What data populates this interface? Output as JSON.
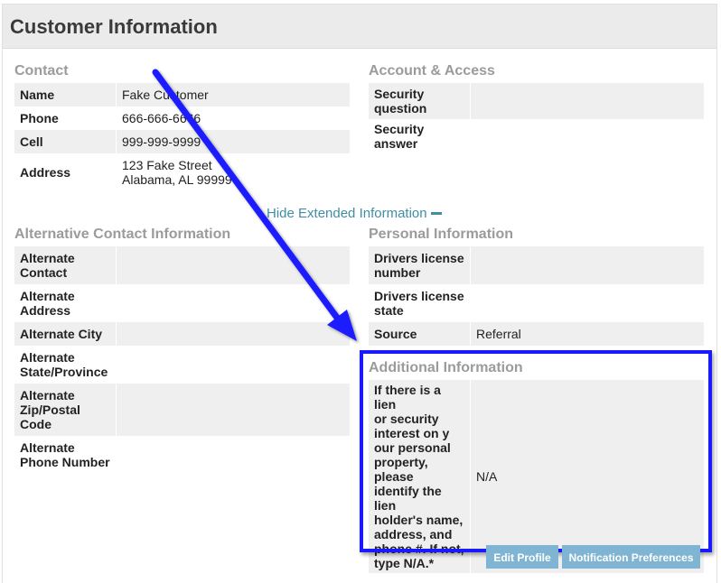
{
  "title": "Customer Information",
  "contact": {
    "heading": "Contact",
    "rows": [
      {
        "label": "Name",
        "value": "Fake Customer"
      },
      {
        "label": "Phone",
        "value": "666-666-6666"
      },
      {
        "label": "Cell",
        "value": "999-999-9999"
      },
      {
        "label": "Address",
        "value_line1": "123 Fake Street",
        "value_line2": "Alabama, AL 99999"
      }
    ]
  },
  "account": {
    "heading": "Account & Access",
    "rows": [
      {
        "label_line1": "Security",
        "label_line2": "question",
        "value": ""
      },
      {
        "label": "Security answer",
        "value": ""
      }
    ]
  },
  "toggle": {
    "label": "Hide Extended Information"
  },
  "alternative": {
    "heading": "Alternative Contact Information",
    "rows": [
      {
        "label_line1": "Alternate",
        "label_line2": "Contact",
        "value": ""
      },
      {
        "label_line1": "Alternate",
        "label_line2": "Address",
        "value": ""
      },
      {
        "label": "Alternate City",
        "value": ""
      },
      {
        "label_line1": "Alternate",
        "label_line2": "State/Province",
        "value": ""
      },
      {
        "label_line1": "Alternate",
        "label_line2": "Zip/Postal",
        "label_line3": "Code",
        "value": ""
      },
      {
        "label_line1": "Alternate",
        "label_line2": "Phone Number",
        "value": ""
      }
    ]
  },
  "personal": {
    "heading": "Personal Information",
    "rows": [
      {
        "label_line1": "Drivers license",
        "label_line2": "number",
        "value": ""
      },
      {
        "label_line1": "Drivers license",
        "label_line2": "state",
        "value": ""
      },
      {
        "label": "Source",
        "value": "Referral"
      }
    ]
  },
  "additional": {
    "heading": "Additional Information",
    "question_lines": [
      "If there is a lien",
      "or security",
      "interest on y",
      "our personal",
      "property, please",
      "identify the lien",
      "holder's name,",
      "address, and",
      "phone #. If not,",
      "type N/A.*"
    ],
    "answer": "N/A"
  },
  "buttons": {
    "edit_profile": "Edit Profile",
    "notification_preferences": "Notification Preferences"
  },
  "colors": {
    "accent_link": "#3f8ea5",
    "annotation_blue": "#1a1aff",
    "button_bg": "#7fb4d2"
  }
}
